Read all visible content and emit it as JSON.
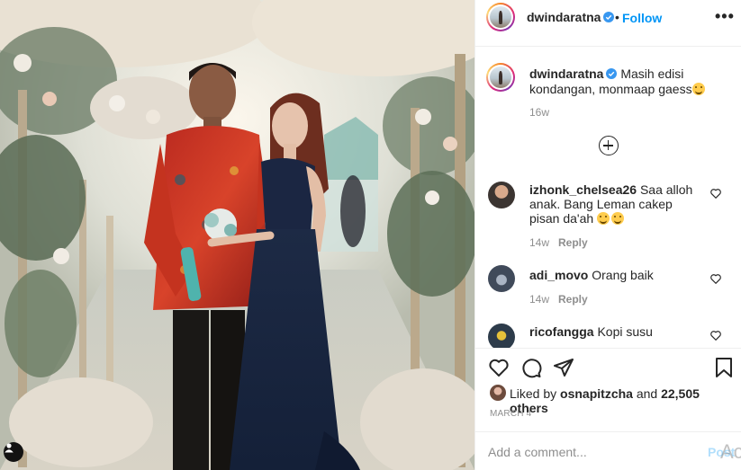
{
  "post": {
    "username": "dwindaratna",
    "follow_separator": "•",
    "follow_label": "Follow",
    "more_label": "•••",
    "caption_text": "Masih edisi kondangan, monmaap gaess",
    "caption_time": "16w",
    "likes_prefix": "Liked by",
    "likes_user": "osnapitzcha",
    "likes_middle": "and",
    "likes_count": "22,505 others",
    "date": "MARCH 4",
    "add_comment_placeholder": "Add a comment...",
    "post_label": "Post",
    "os_watermark": "Act"
  },
  "comments": [
    {
      "username": "izhonk_chelsea26",
      "text": "Saa alloh anak. Bang Leman cakep pisan da'ah",
      "time": "14w",
      "reply_label": "Reply"
    },
    {
      "username": "adi_movo",
      "text": "Orang baik",
      "time": "14w",
      "reply_label": "Reply"
    },
    {
      "username": "ricofangga",
      "text": "Kopi susu"
    }
  ],
  "icons": {
    "verified": "verified-badge-icon",
    "load_more": "plus-circle-icon",
    "like": "heart-icon",
    "comment": "comment-bubble-icon",
    "share": "paper-plane-icon",
    "save": "bookmark-icon",
    "user_tag": "user-tag-icon"
  },
  "colors": {
    "accent_blue": "#0095f6",
    "muted_gray": "#8e8e8e",
    "text_dark": "#262626",
    "post_disabled": "#b2dffc"
  }
}
